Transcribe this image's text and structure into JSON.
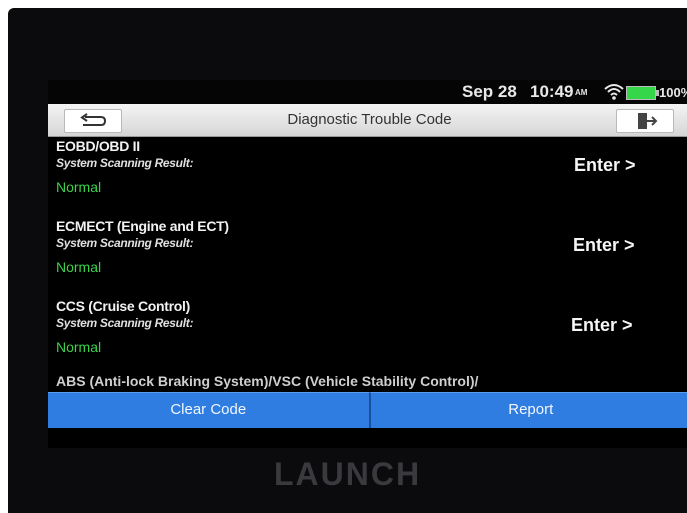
{
  "status_bar": {
    "date": "Sep 28",
    "time": "10:49",
    "ampm": "AM",
    "battery_level": "100%",
    "icons": [
      "wifi-icon",
      "battery-icon"
    ]
  },
  "header": {
    "title": "Diagnostic Trouble Code",
    "back_icon": "back-icon",
    "exit_icon": "exit-icon"
  },
  "systems": [
    {
      "name": "EOBD/OBD II",
      "scan_label": "System Scanning Result:",
      "status": "Normal",
      "action": "Enter >"
    },
    {
      "name": "ECMECT (Engine and ECT)",
      "scan_label": "System Scanning Result:",
      "status": "Normal",
      "action": "Enter >"
    },
    {
      "name": "CCS (Cruise Control)",
      "scan_label": "System Scanning Result:",
      "status": "Normal",
      "action": "Enter >"
    }
  ],
  "partial_row": {
    "name": "ABS (Anti-lock Braking System)/VSC (Vehicle Stability Control)/"
  },
  "footer": {
    "clear_label": "Clear Code",
    "report_label": "Report"
  },
  "brand": "LAUNCH",
  "colors": {
    "accent_blue": "#2f7de0",
    "normal_green": "#3fd04a",
    "battery_green": "#36d64a"
  }
}
